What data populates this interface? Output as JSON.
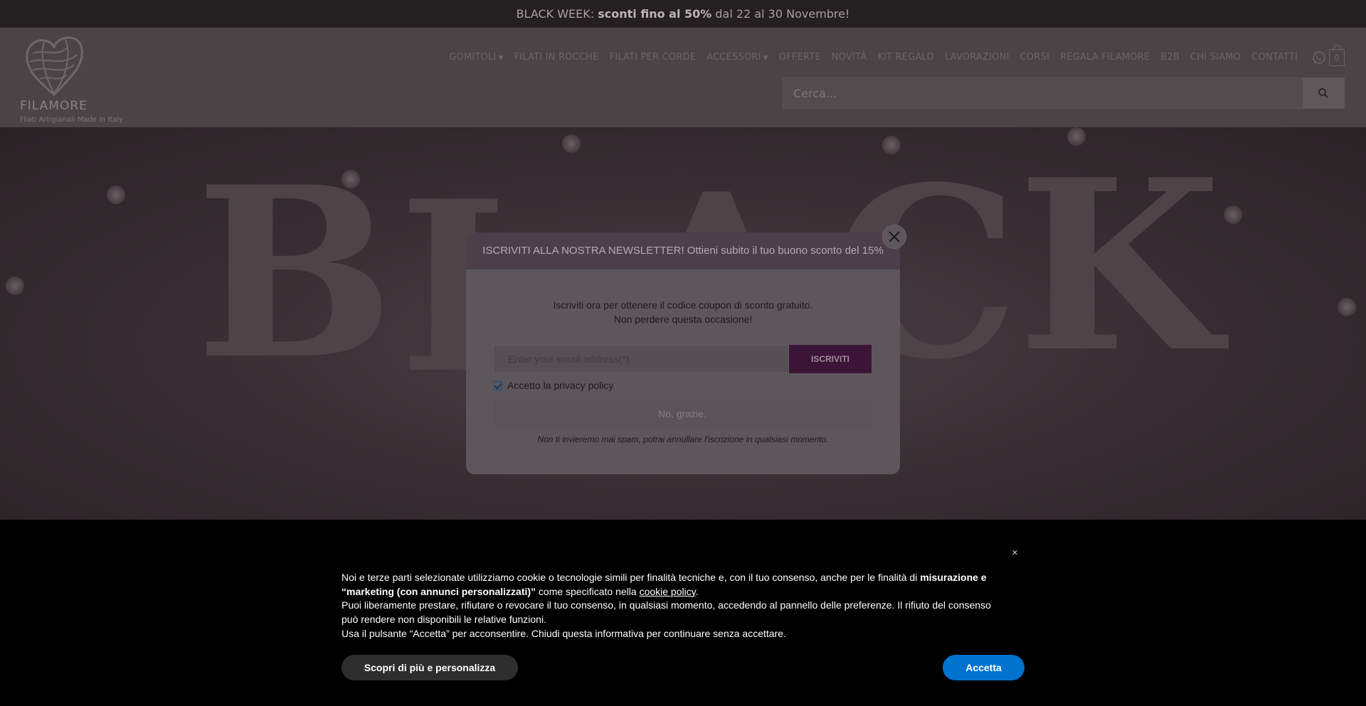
{
  "promo": {
    "part1": "BLACK WEEK: ",
    "bold": "sconti fino al 50%",
    "part2": " dal 22 al 30 Novembre!"
  },
  "header": {
    "logo_text": "FILAMORE",
    "logo_tagline": "Filati Artigianali Made in Italy",
    "nav": [
      {
        "label": "GOMITOLI",
        "dropdown": true
      },
      {
        "label": "FILATI IN ROCCHE",
        "dropdown": false
      },
      {
        "label": "FILATI PER CORDE",
        "dropdown": false
      },
      {
        "label": "ACCESSORI",
        "dropdown": true
      },
      {
        "label": "OFFERTE",
        "dropdown": false
      },
      {
        "label": "NOVITÀ",
        "dropdown": false
      },
      {
        "label": "KIT REGALO",
        "dropdown": false
      },
      {
        "label": "LAVORAZIONI",
        "dropdown": false
      },
      {
        "label": "CORSI",
        "dropdown": false
      },
      {
        "label": "REGALA FILAMORE",
        "dropdown": false
      },
      {
        "label": "B2B",
        "dropdown": false
      },
      {
        "label": "CHI SIAMO",
        "dropdown": false
      },
      {
        "label": "CONTATTI",
        "dropdown": false
      }
    ],
    "cart_count": "0",
    "search_placeholder": "Cerca..."
  },
  "hero": {
    "letters": [
      "B",
      "L",
      "A",
      "C",
      "K"
    ]
  },
  "modal": {
    "header": "ISCRIVITI ALLA NOSTRA NEWSLETTER! Ottieni subito il tuo buono sconto del 15%",
    "lead_line1": "Iscriviti ora per ottenere il codice coupon di sconto gratuito.",
    "lead_line2": "Non perdere questa occasione!",
    "email_placeholder": "Enter your email address(*)",
    "subscribe_label": "ISCRIVITI",
    "consent_label": "Accetto la privacy policy",
    "no_thanks": "No, grazie.",
    "disclaimer": "Non ti invieremo mai spam, potrai annullare l'iscrizione in qualsiasi momento."
  },
  "cookie": {
    "p1_start": "Noi e terze parti selezionate utilizziamo cookie o tecnologie simili per finalità tecniche e, con il tuo consenso, anche per le finalità di ",
    "p1_bold": "misurazione e “marketing (con annunci personalizzati)”",
    "p1_mid": " come specificato nella ",
    "p1_link": "cookie policy",
    "p1_end": ".",
    "p2": "Puoi liberamente prestare, rifiutare o revocare il tuo consenso, in qualsiasi momento, accedendo al pannello delle preferenze. Il rifiuto del consenso può rendere non disponibili le relative funzioni.",
    "p3": "Usa il pulsante “Accetta” per acconsentire. Chiudi questa informativa per continuare senza accettare.",
    "more_label": "Scopri di più e personalizza",
    "accept_label": "Accetta",
    "close_label": "×"
  },
  "colors": {
    "brand_purple": "#6a1b63",
    "accept_blue": "#0073ce"
  },
  "icons": [
    "search-icon",
    "whatsapp-icon",
    "cart-icon",
    "close-icon",
    "chevron-down-icon",
    "checkbox-icon"
  ]
}
